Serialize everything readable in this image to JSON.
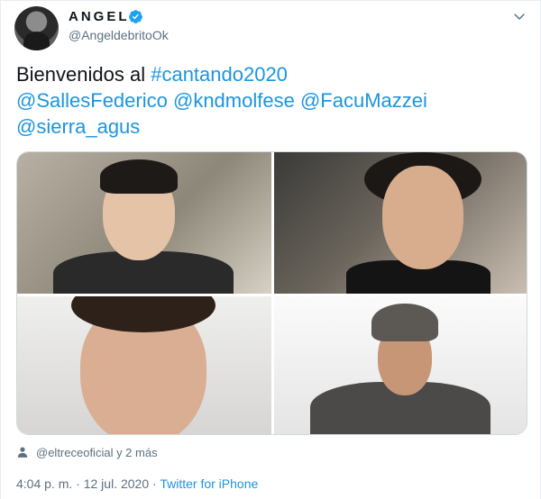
{
  "author": {
    "display_name": "ANGEL",
    "handle": "@AngeldebritoOk",
    "verified": true
  },
  "tweet": {
    "text_prefix": "Bienvenidos al ",
    "hashtag": "#cantando2020",
    "mention_1": "@SallesFederico",
    "mention_2": "@kndmolfese",
    "mention_3": "@FacuMazzei",
    "mention_4": "@sierra_agus"
  },
  "tagged": {
    "text": "@eltreceoficial y 2 más"
  },
  "meta": {
    "time": "4:04 p. m.",
    "separator_1": " · ",
    "date": "12 jul. 2020",
    "separator_2": " · ",
    "source": "Twitter for iPhone"
  },
  "icons": {
    "verified": "verified-badge-icon",
    "menu": "chevron-down-icon",
    "tag": "person-icon"
  },
  "colors": {
    "link": "#1b95e0",
    "secondary_text": "#5b7083",
    "verified": "#1da1f2"
  }
}
